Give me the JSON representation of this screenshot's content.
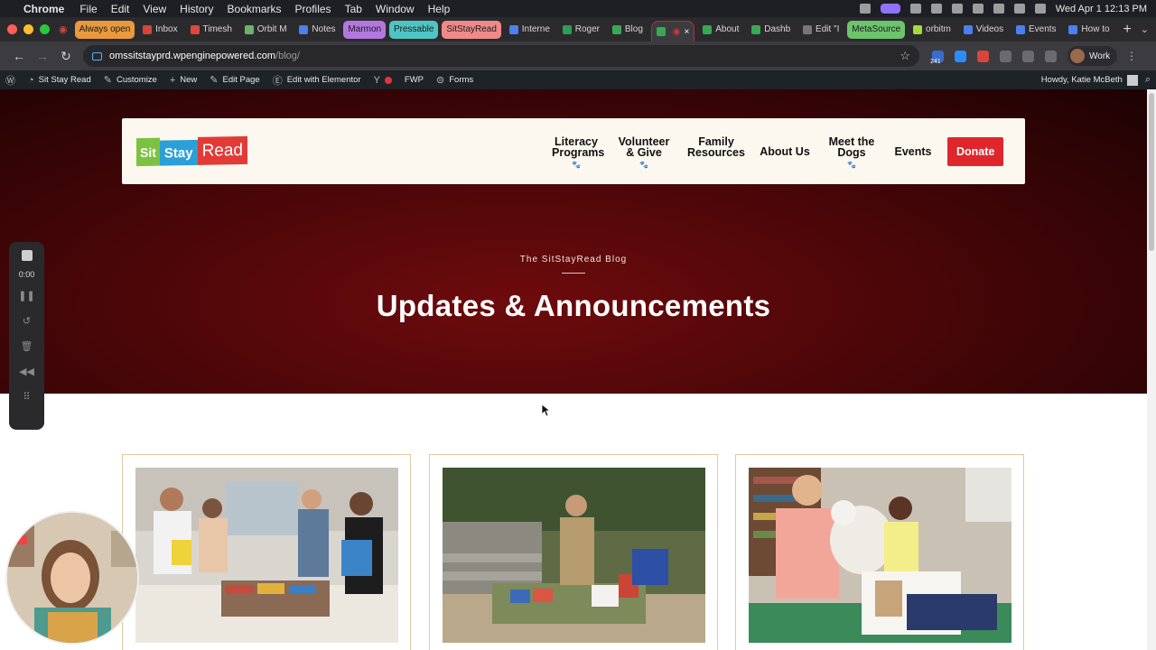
{
  "menubar": {
    "app": "Chrome",
    "items": [
      "File",
      "Edit",
      "View",
      "History",
      "Bookmarks",
      "Profiles",
      "Tab",
      "Window",
      "Help"
    ],
    "datetime": "Wed Apr 1  12:13 PM"
  },
  "tabs": [
    {
      "label": "Always open",
      "kind": "pill",
      "color": "#e89a3c"
    },
    {
      "label": "Inbox",
      "fav": "#d44638"
    },
    {
      "label": "Timesh",
      "fav": "#e0473c"
    },
    {
      "label": "Orbit M",
      "fav": "#6bb36b"
    },
    {
      "label": "Notes",
      "fav": "#4a80f0"
    },
    {
      "label": "Marmon",
      "kind": "pill",
      "color": "#b377e0"
    },
    {
      "label": "Pressable",
      "kind": "pill",
      "color": "#4fc4c4"
    },
    {
      "label": "SitStayRead",
      "kind": "pill",
      "color": "#f08a8a"
    },
    {
      "label": "Interne",
      "fav": "#4a80f0"
    },
    {
      "label": "Roger",
      "fav": "#2e9d55"
    },
    {
      "label": "Blog",
      "fav": "#3aa852"
    },
    {
      "label": "",
      "fav": "#3aa852",
      "active": true
    },
    {
      "label": "About",
      "fav": "#3aa852"
    },
    {
      "label": "Dashb",
      "fav": "#3aa852"
    },
    {
      "label": "Edit \"I",
      "fav": "#777"
    },
    {
      "label": "MetaSource",
      "kind": "pill",
      "color": "#6cc46c"
    },
    {
      "label": "orbitm",
      "fav": "#a6d93a"
    },
    {
      "label": "Videos",
      "fav": "#4a80f0"
    },
    {
      "label": "Events",
      "fav": "#4a80f0"
    },
    {
      "label": "How to",
      "fav": "#4a80f0"
    }
  ],
  "address": {
    "host": "omssitstayprd.wpenginepowered.com",
    "path": "/blog/",
    "profile": "Work",
    "badge": "241"
  },
  "wpbar": {
    "site": "Sit Stay Read",
    "customize": "Customize",
    "new": "New",
    "edit_page": "Edit Page",
    "elementor": "Edit with Elementor",
    "fwp": "FWP",
    "forms": "Forms",
    "howdy": "Howdy, Katie McBeth"
  },
  "site": {
    "logo": {
      "sit": "Sit",
      "stay": "Stay",
      "read": "Read"
    },
    "nav": [
      {
        "line1": "Literacy",
        "line2": "Programs",
        "paw": true
      },
      {
        "line1": "Volunteer",
        "line2": "& Give",
        "paw": true
      },
      {
        "line1": "Family",
        "line2": "Resources",
        "paw": false
      },
      {
        "line1": "About Us",
        "line2": "",
        "paw": false
      },
      {
        "line1": "Meet the",
        "line2": "Dogs",
        "paw": true
      },
      {
        "line1": "Events",
        "line2": "",
        "paw": false
      }
    ],
    "donate": "Donate",
    "eyebrow": "The SitStayRead Blog",
    "title": "Updates & Announcements",
    "colors": {
      "hero": "#4a0608",
      "donate": "#e0262d",
      "header_bg": "#fdf8ef",
      "card_border": "#e2c9a0"
    }
  },
  "recorder": {
    "timer": "0:00"
  }
}
